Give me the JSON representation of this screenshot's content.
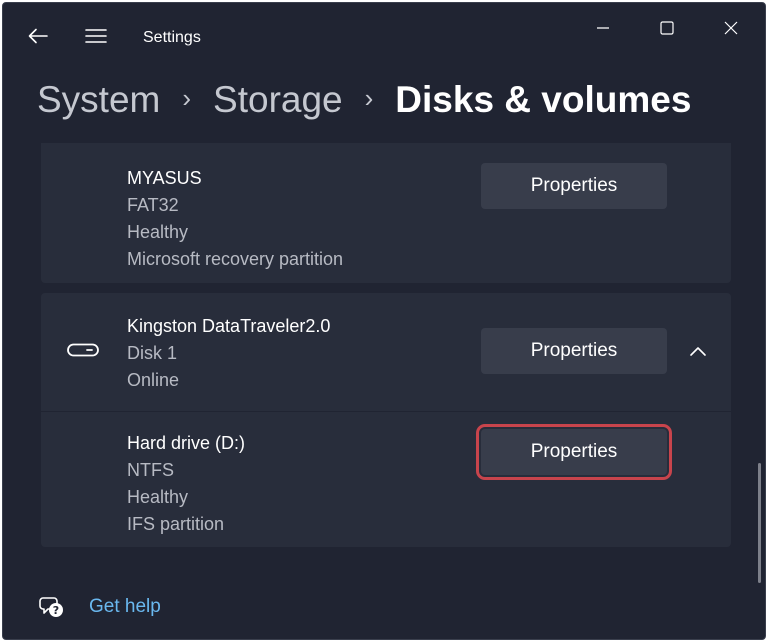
{
  "window": {
    "title": "Settings",
    "back_icon": "arrow-left-icon",
    "menu_icon": "hamburger-menu-icon",
    "controls": [
      "minimize-icon",
      "maximize-icon",
      "close-icon"
    ]
  },
  "breadcrumb": {
    "items": [
      "System",
      "Storage",
      "Disks & volumes"
    ],
    "separator": "›"
  },
  "volumes": [
    {
      "name": "MYASUS",
      "file_system": "FAT32",
      "status": "Healthy",
      "type": "Microsoft recovery partition",
      "button": "Properties"
    }
  ],
  "disk": {
    "name": "Kingston DataTraveler2.0",
    "number": "Disk 1",
    "status": "Online",
    "button": "Properties",
    "icon": "usb-drive-icon",
    "expander_icon": "chevron-up-icon"
  },
  "disk_volume": {
    "name": "Hard drive (D:)",
    "file_system": "NTFS",
    "status": "Healthy",
    "type": "IFS partition",
    "button": "Properties"
  },
  "help": {
    "label": "Get help",
    "icon": "help-chat-icon"
  },
  "colors": {
    "background": "#202432",
    "card": "#282d3b",
    "button": "#383d4b",
    "highlight": "#c8444c",
    "link": "#6ab8ef"
  }
}
